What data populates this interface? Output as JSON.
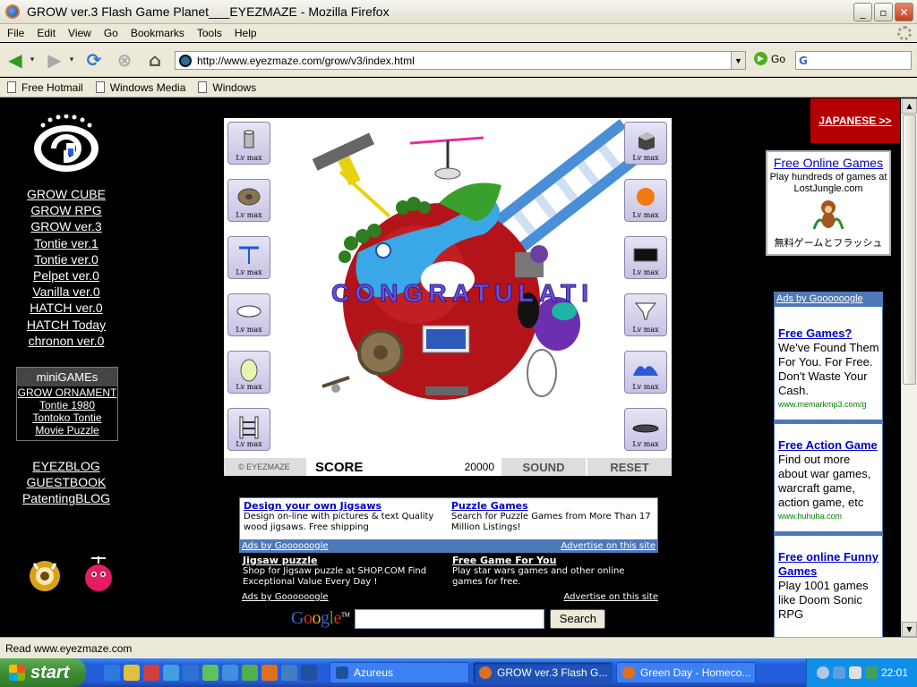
{
  "window": {
    "title": "GROW ver.3 Flash Game Planet___EYEZMAZE - Mozilla Firefox",
    "min": "_",
    "max": "▫",
    "close": "✕"
  },
  "menu": [
    "File",
    "Edit",
    "View",
    "Go",
    "Bookmarks",
    "Tools",
    "Help"
  ],
  "nav": {
    "url": "http://www.eyezmaze.com/grow/v3/index.html",
    "go_label": "Go",
    "search_glyph": "G"
  },
  "bookmarks": [
    "Free Hotmail",
    "Windows Media",
    "Windows"
  ],
  "left_nav": {
    "links": [
      "GROW CUBE",
      "GROW RPG",
      "GROW ver.3",
      "Tontie ver.1",
      "Tontie ver.0",
      "Pelpet ver.0",
      "Vanilla ver.0",
      "HATCH ver.0",
      "HATCH Today",
      "chronon ver.0"
    ],
    "minigames_title": "miniGAMEs",
    "minigames": [
      "GROW ORNAMENT",
      "Tontie 1980",
      "Tontoko Tontie",
      "Movie Puzzle"
    ],
    "blogs": [
      "EYEZBLOG",
      "GUESTBOOK",
      "PatentingBLOG"
    ]
  },
  "game": {
    "slot_label": "Lv max",
    "congrats": "CONGRATULATI",
    "brand": "© EYEZMAZE",
    "score_label": "SCORE",
    "score_value": "20000",
    "sound_label": "SOUND",
    "reset_label": "RESET"
  },
  "ads_box": {
    "ad1_title": "Design your own Jigsaws",
    "ad1_text": "Design on-line with pictures & text Quality wood jigsaws. Free shipping",
    "ad2_title": "Puzzle Games",
    "ad2_text": "Search for Puzzle Games from More Than 17 Million Listings!",
    "ads_by": "Ads by Goooooogle",
    "advertise": "Advertise on this site"
  },
  "ads_box2": {
    "ad1_title": "Jigsaw puzzle",
    "ad1_text": "Shop for Jigsaw puzzle at SHOP.COM Find Exceptional Value Every Day !",
    "ad2_title": "Free Game For You",
    "ad2_text": "Play star wars games and other online games for free.",
    "ads_by": "Ads by Goooooogle",
    "advertise": "Advertise on this site"
  },
  "google": {
    "logo": "Google",
    "tm": "TM",
    "button": "Search"
  },
  "right": {
    "japanese": "JAPANESE >>",
    "lj_title": "Free Online Games",
    "lj_text": "Play hundreds of games at LostJungle.com",
    "lj_japanese": "無料ゲームとフラッシュ",
    "side_ads_header": "Ads by Goooooogle",
    "side_ads": [
      {
        "title": "Free Games?",
        "text": "We've Found Them For You. For Free. Don't Waste Your Cash.",
        "url": "www.memarkmp3.com/g"
      },
      {
        "title": "Free Action Game",
        "text": "Find out more about war games, warcraft game, action game, etc",
        "url": "www.huhuha.com"
      },
      {
        "title": "Free online Funny Games",
        "text": "Play 1001 games like Doom Sonic RPG",
        "url": ""
      }
    ]
  },
  "status": "Read www.eyezmaze.com",
  "taskbar": {
    "start": "start",
    "tasks": [
      "Azureus",
      "GROW ver.3 Flash G...",
      "Green Day - Homeco..."
    ],
    "clock": "22:01"
  },
  "colors": {
    "accent_red": "#b40000",
    "ad_blue": "#4e79b8",
    "link_blue": "#0000cc",
    "planet_red": "#b3141a"
  }
}
